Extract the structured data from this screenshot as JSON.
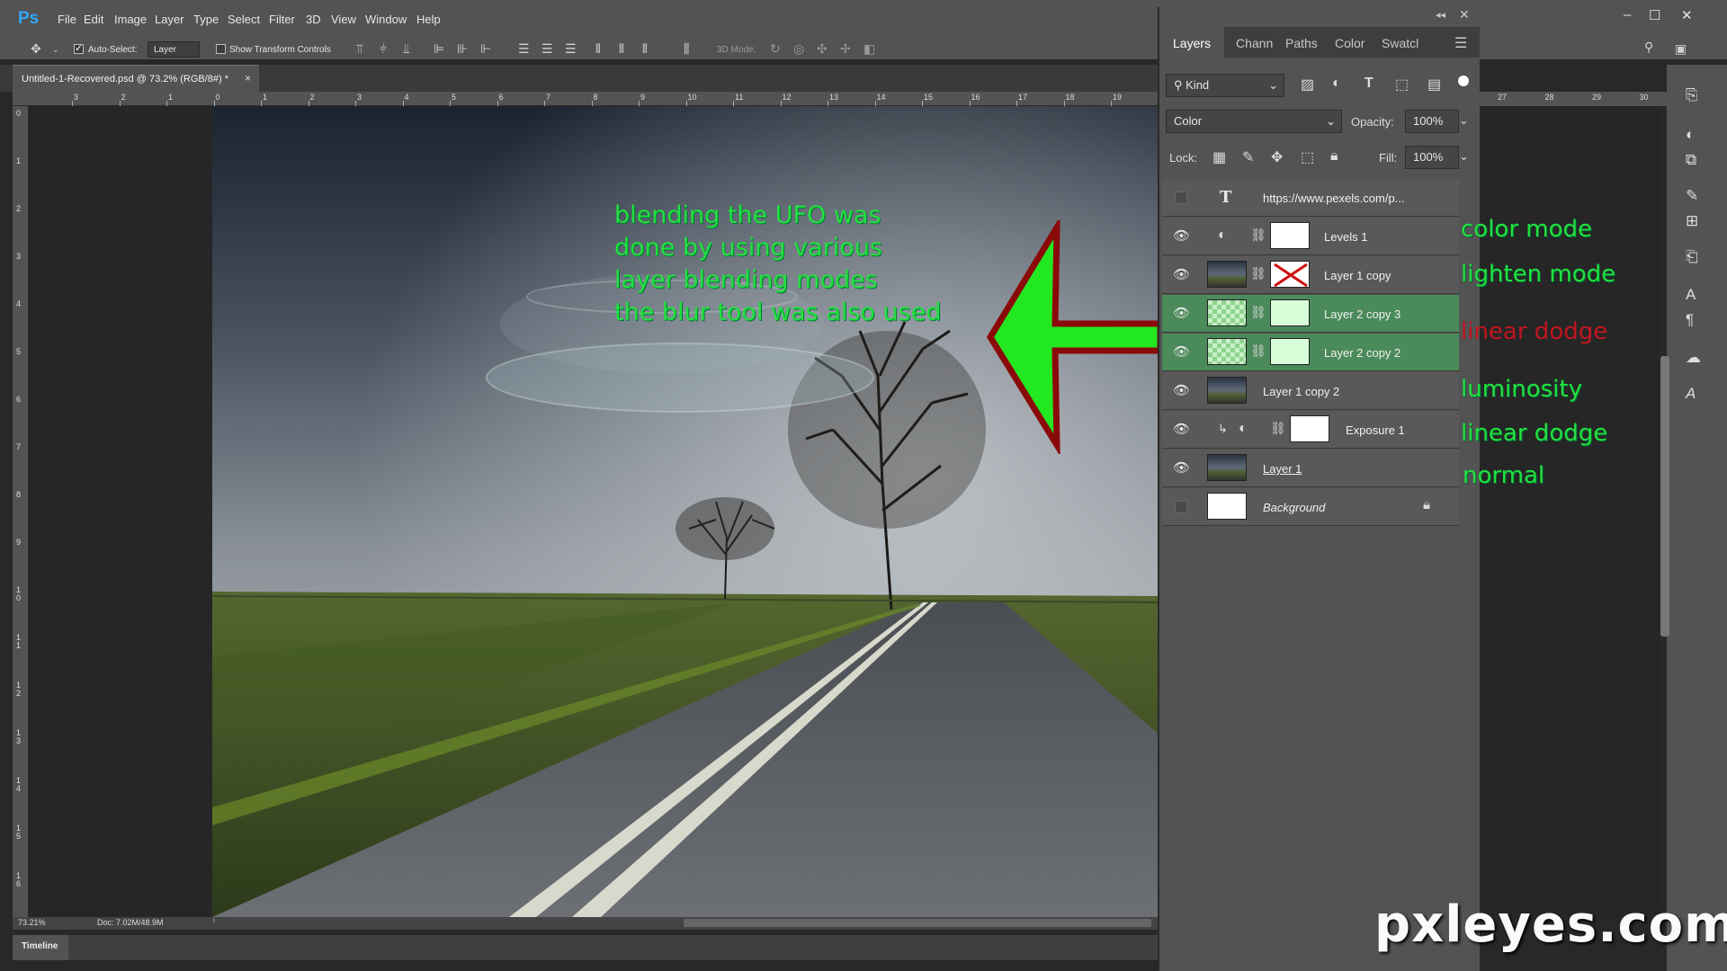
{
  "app": {
    "logo": "Ps"
  },
  "menu": [
    "File",
    "Edit",
    "Image",
    "Layer",
    "Type",
    "Select",
    "Filter",
    "3D",
    "View",
    "Window",
    "Help"
  ],
  "window_controls": {
    "minimize": "–",
    "maximize": "☐",
    "close": "✕"
  },
  "options_bar": {
    "auto_select_label": "Auto-Select:",
    "auto_select_target": "Layer",
    "show_transform_label": "Show Transform Controls",
    "mode_3d_label": "3D Mode:"
  },
  "document": {
    "tab_label": "Untitled-1-Recovered.psd @ 73.2% (RGB/8#) *",
    "tab_close": "×",
    "zoom": "73.21%",
    "doc_size": "Doc: 7.02M/48.9M"
  },
  "ruler": {
    "top": [
      "3",
      "2",
      "1",
      "0",
      "1",
      "2",
      "3",
      "4",
      "5",
      "6",
      "7",
      "8",
      "9",
      "10",
      "11",
      "12",
      "13",
      "14",
      "15",
      "16",
      "17",
      "18",
      "19"
    ],
    "right": [
      "27",
      "28",
      "29",
      "30"
    ],
    "left": [
      "0",
      "1",
      "2",
      "3",
      "4",
      "5",
      "6",
      "7",
      "8",
      "9",
      "1\n0",
      "1\n1",
      "1\n2",
      "1\n3",
      "1\n4",
      "1\n5",
      "1\n6"
    ]
  },
  "canvas_text": [
    "blending the UFO was",
    "done by using various",
    "layer blending modes",
    "the blur tool was also used"
  ],
  "timeline": {
    "label": "Timeline"
  },
  "layers_panel": {
    "tabs": [
      "Layers",
      "Chann",
      "Paths",
      "Color",
      "Swatcl"
    ],
    "filter_kind": "Kind",
    "blend_mode": "Color",
    "opacity_label": "Opacity:",
    "opacity_value": "100%",
    "lock_label": "Lock:",
    "fill_label": "Fill:",
    "fill_value": "100%",
    "layers": [
      {
        "name": "https://www.pexels.com/p...",
        "kind": "text",
        "visible": false
      },
      {
        "name": "Levels 1",
        "kind": "adjustment",
        "visible": true
      },
      {
        "name": "Layer 1 copy",
        "kind": "masked",
        "visible": true
      },
      {
        "name": "Layer 2 copy 3",
        "kind": "masked",
        "visible": true,
        "selected": true
      },
      {
        "name": "Layer 2 copy 2",
        "kind": "masked",
        "visible": true,
        "selected": true
      },
      {
        "name": "Layer 1 copy 2",
        "kind": "photo",
        "visible": true
      },
      {
        "name": "Exposure 1",
        "kind": "adjustment",
        "visible": true
      },
      {
        "name": "Layer 1",
        "kind": "photo",
        "visible": true
      },
      {
        "name": "Background",
        "kind": "background",
        "visible": false
      }
    ]
  },
  "annotations": [
    "color mode",
    "lighten mode",
    "linear dodge",
    "luminosity",
    "linear dodge",
    "normal"
  ],
  "watermark": "pxleyes.com",
  "colors": {
    "annotation_green": "#22e040",
    "annotation_red": "#c0161f",
    "arrow_fill": "#22e822",
    "arrow_stroke": "#8a0a0a",
    "selected_layer": "#4b8a5a",
    "ps_blue": "#31a8ff"
  }
}
